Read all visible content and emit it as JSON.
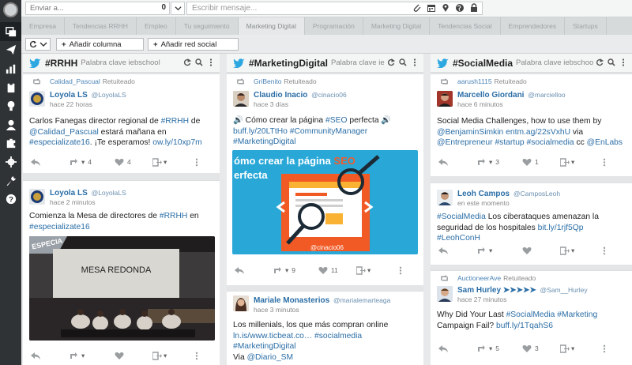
{
  "compose": {
    "send_to_placeholder": "Enviar a...",
    "send_to_count": "0",
    "message_placeholder": "Escribir mensaje..."
  },
  "tabs": [
    {
      "label": "Empresa"
    },
    {
      "label": "Tendencias RRHH"
    },
    {
      "label": "Empleo"
    },
    {
      "label": "Tu seguimiento"
    },
    {
      "label": "Marketing Digital"
    },
    {
      "label": "Programación"
    },
    {
      "label": "Marketing Digital"
    },
    {
      "label": "Tendencias Social"
    },
    {
      "label": "Emprendedores"
    },
    {
      "label": "Startups"
    }
  ],
  "toolbar": {
    "add_column": "Añadir columna",
    "add_network": "Añadir red social"
  },
  "columns": [
    {
      "title": "#RRHH",
      "subtitle": "Palabra clave iebschool",
      "cards": [
        {
          "retweet_user": "Calidad_Pascual",
          "retweet_label": "Retuiteado",
          "name": "Loyola LS",
          "handle": "@LoyolaLS",
          "time": "hace 22 horas",
          "text_a": "Carlos Fanegas director regional de ",
          "link_a": "#RRHH",
          "text_b": " de ",
          "link_b": "@Calidad_Pascual",
          "text_c": " estará mañana en ",
          "link_c": "#especializate16",
          "text_d": ". ¡Te esperamos! ",
          "link_d": "ow.ly/10xp7m",
          "retweets": "4",
          "likes": "4"
        },
        {
          "name": "Loyola LS",
          "handle": "@LoyolaLS",
          "time": "hace 2 minutos",
          "text_a": "Comienza la Mesa de directores de ",
          "link_a": "#RRHH",
          "text_b": " en ",
          "link_b": "#especializate16",
          "image_banner": "ESPECIA",
          "image_caption": "MESA REDONDA"
        }
      ]
    },
    {
      "title": "#MarketingDigital",
      "subtitle": "Palabra clave ie",
      "cards": [
        {
          "retweet_user": "GriBenito",
          "retweet_label": "Retuiteado",
          "name": "Claudio Inacio",
          "handle": "@cinacio06",
          "time": "hace 3 días",
          "text_a": "🔊 Cómo crear la página ",
          "link_a": "#SEO",
          "text_b": " perfecta 🔊",
          "link_b": "buff.ly/20LTtHo",
          "link_c": "#CommunityManager",
          "link_d": "#MarketingDigital",
          "image_title_a": "ómo crear la página",
          "image_title_seo": "SEO",
          "image_title_b": "erfecta",
          "image_credit": "@cinacio06",
          "retweets": "9",
          "likes": "11"
        },
        {
          "name": "Mariale Monasterios",
          "handle": "@marialemarteaga",
          "time": "hace 3 minutos",
          "text_a": "Los millenials, los que más compran online",
          "link_a": "ln.is/www.ticbeat.co…",
          "link_b": "#socialmedia",
          "link_c": "#MarketingDigital",
          "text_b": "Via ",
          "link_d": "@Diario_SM"
        }
      ]
    },
    {
      "title": "#SocialMedia",
      "subtitle": "Palabra clave iebschool",
      "cards": [
        {
          "retweet_user": "aarush1115",
          "retweet_label": "Retuiteado",
          "name": "Marcello Giordani",
          "handle": "@marcielloo",
          "time": "hace 6 minutos",
          "text_a": "Social Media Challenges, how to use them by",
          "link_a": "@BenjaminSimkin",
          "link_b": "entm.ag/22sVxhU",
          "text_b": " via",
          "link_c": "@Entrepreneur",
          "link_d": "#startup",
          "link_e": "#socialmedia",
          "text_c": " cc ",
          "link_f": "@EnLabs",
          "retweets": "3",
          "likes": "1"
        },
        {
          "name": "Leoh Campos",
          "handle": "@CamposLeoh",
          "time": "en este momento",
          "link_a": "#SocialMedia",
          "text_a": " Los ciberataques amenazan la seguridad de los hospitales ",
          "link_b": "bit.ly/1rjf5Qp",
          "link_c": "#LeohConH"
        },
        {
          "retweet_user": "AuctioneerAve",
          "retweet_label": "Retuiteado",
          "name": "Sam Hurley ➤➤➤➤➤",
          "handle": "@Sam__Hurley",
          "time": "hace 27 minutos",
          "text_a": "Why Did Your Last ",
          "link_a": "#SocialMedia",
          "link_b": "#Marketing",
          "text_b": "Campaign Fail? ",
          "link_c": "buff.ly/1TqahS6",
          "retweets": "5",
          "likes": "3"
        }
      ]
    }
  ]
}
